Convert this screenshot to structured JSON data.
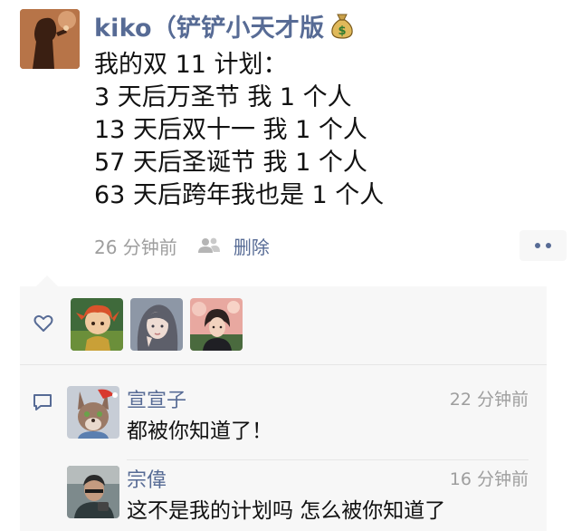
{
  "post": {
    "author": "kiko（铲铲小天才版",
    "author_emoji_icon": "money-bag-icon",
    "lines": [
      "我的双 11 计划：",
      "3 天后万圣节 我 1 个人",
      "13 天后双十一 我 1 个人",
      "57 天后圣诞节 我 1 个人",
      "63 天后跨年我也是 1 个人"
    ],
    "time_ago": "26 分钟前",
    "visibility_icon": "friends-icon",
    "delete_label": "删除",
    "more_icon": "more-dots-icon"
  },
  "likes": {
    "icon": "heart-icon",
    "avatars": [
      "liker-avatar-1",
      "liker-avatar-2",
      "liker-avatar-3"
    ]
  },
  "comments": {
    "icon": "comment-icon",
    "items": [
      {
        "name": "宣宣子",
        "time": "22 分钟前",
        "text": "都被你知道了！"
      },
      {
        "name": "宗偉",
        "time": "16 分钟前",
        "text": "这不是我的计划吗 怎么被你知道了"
      }
    ]
  },
  "colors": {
    "link_blue": "#576b95",
    "meta_gray": "#9e9e9e",
    "panel_bg": "#f7f7f7"
  }
}
